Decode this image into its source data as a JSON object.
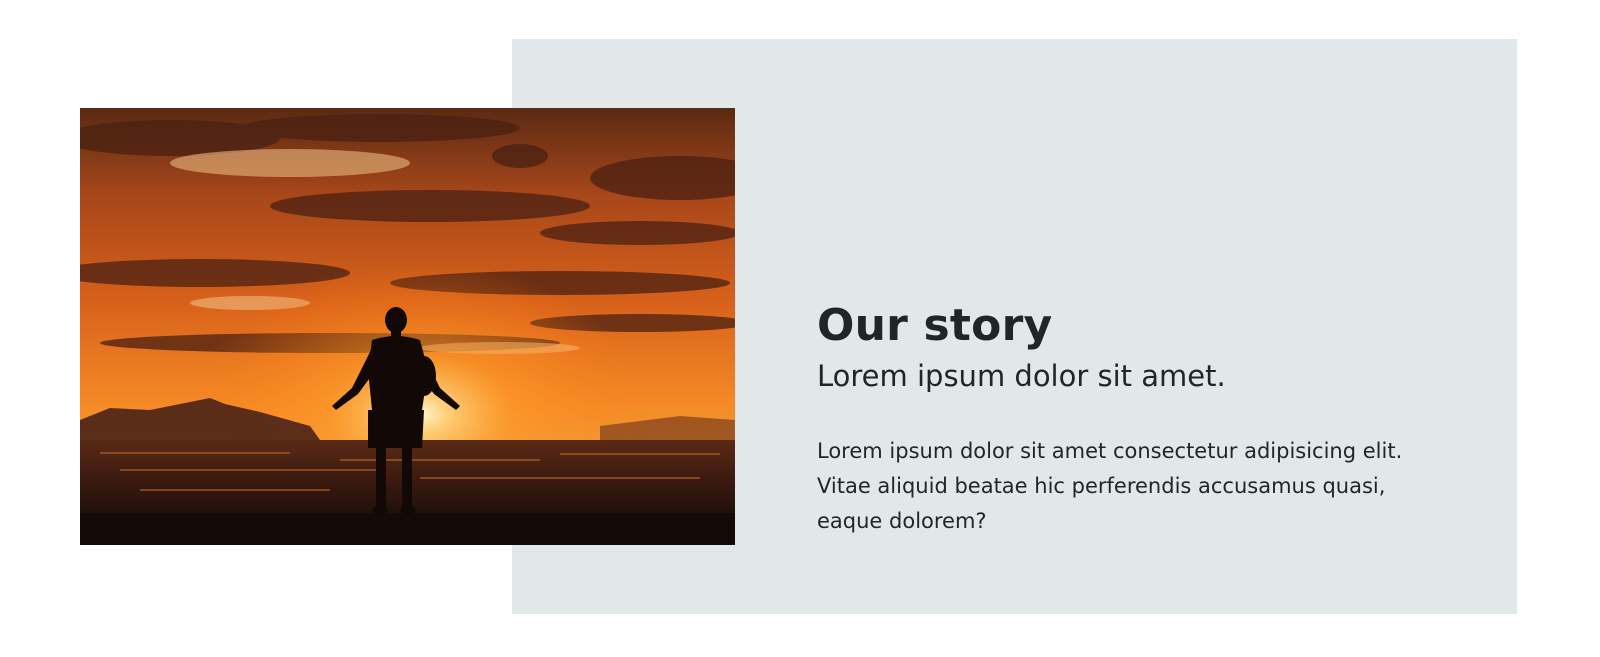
{
  "story": {
    "title": "Our story",
    "subtitle": "Lorem ipsum dolor sit amet.",
    "body": "Lorem ipsum dolor sit amet consectetur adipisicing elit. Vitae aliquid beatae hic perferendis accusamus quasi, eaque dolorem?"
  },
  "colors": {
    "panel_background": "#e2e8e9",
    "text": "#1f2626"
  },
  "image": {
    "icon": "sunset-person-photo"
  }
}
